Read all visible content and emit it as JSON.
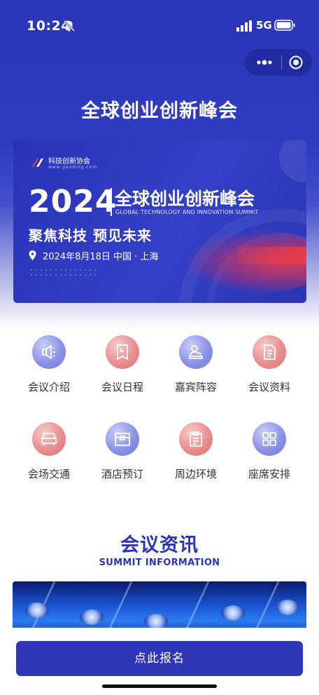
{
  "status_bar": {
    "time": "10:24",
    "network": "5G"
  },
  "header": {
    "title": "全球创业创新峰会"
  },
  "banner": {
    "org": "科技创新协会",
    "url": "www.gaoding.com",
    "year": "2024",
    "title": "全球创业创新峰会",
    "subtitle_en": "GLOBAL TECHNOLOGY AND INNOVATION SUMMIT",
    "slogan": "聚焦科技  预见未来",
    "date_location": "2024年8月18日 中国 · 上海"
  },
  "menu": [
    {
      "label": "会议介绍",
      "icon": "megaphone-icon",
      "tone": "blue"
    },
    {
      "label": "会议日程",
      "icon": "schedule-icon",
      "tone": "red"
    },
    {
      "label": "嘉宾阵容",
      "icon": "guest-icon",
      "tone": "blue"
    },
    {
      "label": "会议资料",
      "icon": "document-icon",
      "tone": "red"
    },
    {
      "label": "会场交通",
      "icon": "car-icon",
      "tone": "red"
    },
    {
      "label": "酒店预订",
      "icon": "hotel-icon",
      "tone": "blue"
    },
    {
      "label": "周边环境",
      "icon": "clipboard-icon",
      "tone": "red"
    },
    {
      "label": "座席安排",
      "icon": "seating-grid-icon",
      "tone": "blue"
    }
  ],
  "info_section": {
    "title": "会议资讯",
    "subtitle": "SUMMIT INFORMATION"
  },
  "cta": {
    "label": "点此报名"
  },
  "colors": {
    "primary": "#2f36b7",
    "icon_blue": "#7b84e2",
    "icon_red": "#e27f7f"
  }
}
